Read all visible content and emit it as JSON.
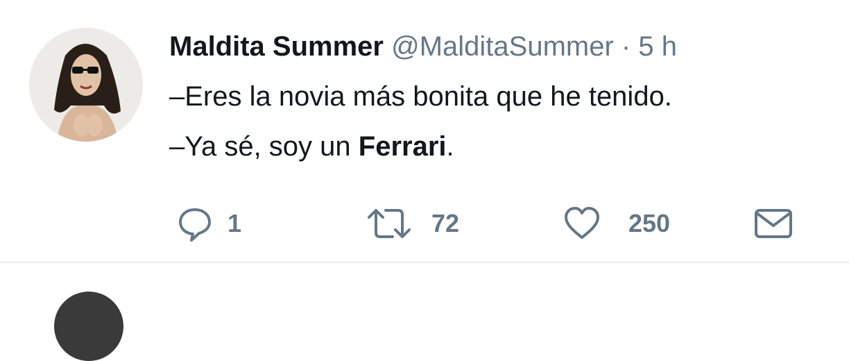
{
  "tweet": {
    "author_name": "Maldita Summer",
    "handle": "@MalditaSummer",
    "separator": "·",
    "time": "5 h",
    "line1": "–Eres la novia más bonita que he tenido.",
    "line2_prefix": "–Ya sé, soy un ",
    "line2_bold": "Ferrari",
    "line2_suffix": "."
  },
  "actions": {
    "reply_count": "1",
    "retweet_count": "72",
    "like_count": "250"
  },
  "icons": [
    "reply-icon",
    "retweet-icon",
    "like-icon",
    "direct-message-icon"
  ],
  "colors": {
    "text": "#14171a",
    "secondary": "#657786",
    "divider": "#e6ecf0"
  }
}
